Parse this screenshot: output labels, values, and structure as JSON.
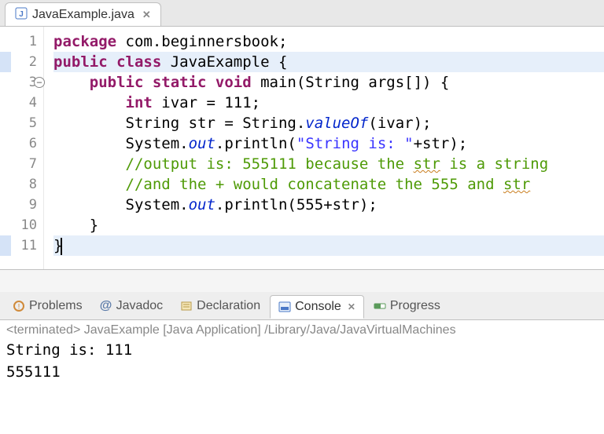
{
  "editor": {
    "tab_filename": "JavaExample.java",
    "gutter": {
      "fold_at_line": 3
    },
    "lines": [
      {
        "n": 1,
        "tokens": [
          [
            "kw",
            "package"
          ],
          [
            "",
            " com.beginnersbook;"
          ]
        ]
      },
      {
        "n": 2,
        "tokens": [
          [
            "kw",
            "public class"
          ],
          [
            "",
            " JavaExample {"
          ]
        ],
        "highlight": true
      },
      {
        "n": 3,
        "tokens": [
          [
            "",
            "    "
          ],
          [
            "kw",
            "public static void"
          ],
          [
            "",
            " main(String args[]) {"
          ]
        ]
      },
      {
        "n": 4,
        "tokens": [
          [
            "",
            "        "
          ],
          [
            "kw",
            "int"
          ],
          [
            "",
            " ivar = 111;"
          ]
        ]
      },
      {
        "n": 5,
        "tokens": [
          [
            "",
            "        String str = String."
          ],
          [
            "ital",
            "valueOf"
          ],
          [
            "",
            "(ivar);"
          ]
        ]
      },
      {
        "n": 6,
        "tokens": [
          [
            "",
            "        System."
          ],
          [
            "ital",
            "out"
          ],
          [
            "",
            ".println("
          ],
          [
            "str",
            "\"String is: \""
          ],
          [
            "",
            "+str);"
          ]
        ]
      },
      {
        "n": 7,
        "tokens": [
          [
            "comment",
            "        //output is: 555111 because the "
          ],
          [
            "comment err-underline",
            "str"
          ],
          [
            "comment",
            " is a string"
          ]
        ]
      },
      {
        "n": 8,
        "tokens": [
          [
            "comment",
            "        //and the + would concatenate the 555 and "
          ],
          [
            "comment err-underline",
            "str"
          ]
        ]
      },
      {
        "n": 9,
        "tokens": [
          [
            "",
            "        System."
          ],
          [
            "ital",
            "out"
          ],
          [
            "",
            ".println(555+str);"
          ]
        ]
      },
      {
        "n": 10,
        "tokens": [
          [
            "",
            "    }"
          ]
        ]
      },
      {
        "n": 11,
        "tokens": [
          [
            "",
            "}"
          ]
        ],
        "highlight": true,
        "cursor_after": true
      }
    ]
  },
  "bottom_tabs": {
    "items": [
      {
        "label": "Problems",
        "icon": "problems-icon"
      },
      {
        "label": "Javadoc",
        "icon": "javadoc-icon",
        "at_prefix": "@"
      },
      {
        "label": "Declaration",
        "icon": "declaration-icon"
      },
      {
        "label": "Console",
        "icon": "console-icon",
        "active": true,
        "closable": true
      },
      {
        "label": "Progress",
        "icon": "progress-icon"
      }
    ]
  },
  "console": {
    "header": "<terminated> JavaExample [Java Application] /Library/Java/JavaVirtualMachines",
    "output_lines": [
      "String is: 111",
      "555111"
    ]
  }
}
